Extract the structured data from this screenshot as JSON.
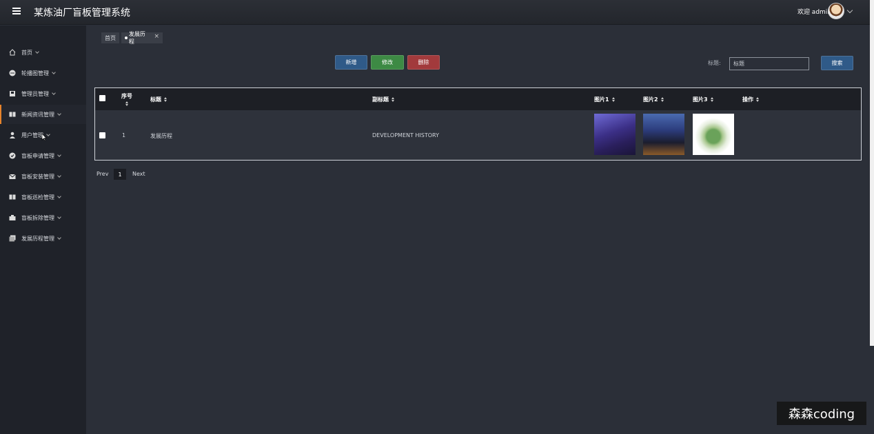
{
  "header": {
    "title": "某炼油厂盲板管理系统",
    "welcome": "欢迎 admin"
  },
  "sidebar": {
    "items": [
      {
        "label": "首页",
        "icon": "home-icon"
      },
      {
        "label": "轮播图管理",
        "icon": "carousel-icon"
      },
      {
        "label": "管理员管理",
        "icon": "admin-icon"
      },
      {
        "label": "新闻资讯管理",
        "icon": "news-icon"
      },
      {
        "label": "用户管理",
        "icon": "user-icon"
      },
      {
        "label": "盲板申请管理",
        "icon": "apply-icon"
      },
      {
        "label": "盲板安装管理",
        "icon": "install-icon"
      },
      {
        "label": "盲板巡检管理",
        "icon": "inspect-icon"
      },
      {
        "label": "盲板拆除管理",
        "icon": "remove-icon"
      },
      {
        "label": "发展历程管理",
        "icon": "history-icon"
      }
    ],
    "active_index": 3
  },
  "tabs": {
    "home": "首页",
    "current": "发展历程"
  },
  "toolbar": {
    "add": "新增",
    "edit": "修改",
    "delete": "删除",
    "search_label": "标题:",
    "search_value": "标题",
    "search": "搜索"
  },
  "table": {
    "headers": {
      "index": "序号",
      "title": "标题",
      "subtitle": "副标题",
      "img1": "图片1",
      "img2": "图片2",
      "img3": "图片3",
      "action": "操作"
    },
    "rows": [
      {
        "index": "1",
        "title": "发展历程",
        "subtitle": "DEVELOPMENT HISTORY"
      }
    ]
  },
  "pagination": {
    "prev": "Prev",
    "current": "1",
    "next": "Next"
  },
  "watermark": "森森coding"
}
